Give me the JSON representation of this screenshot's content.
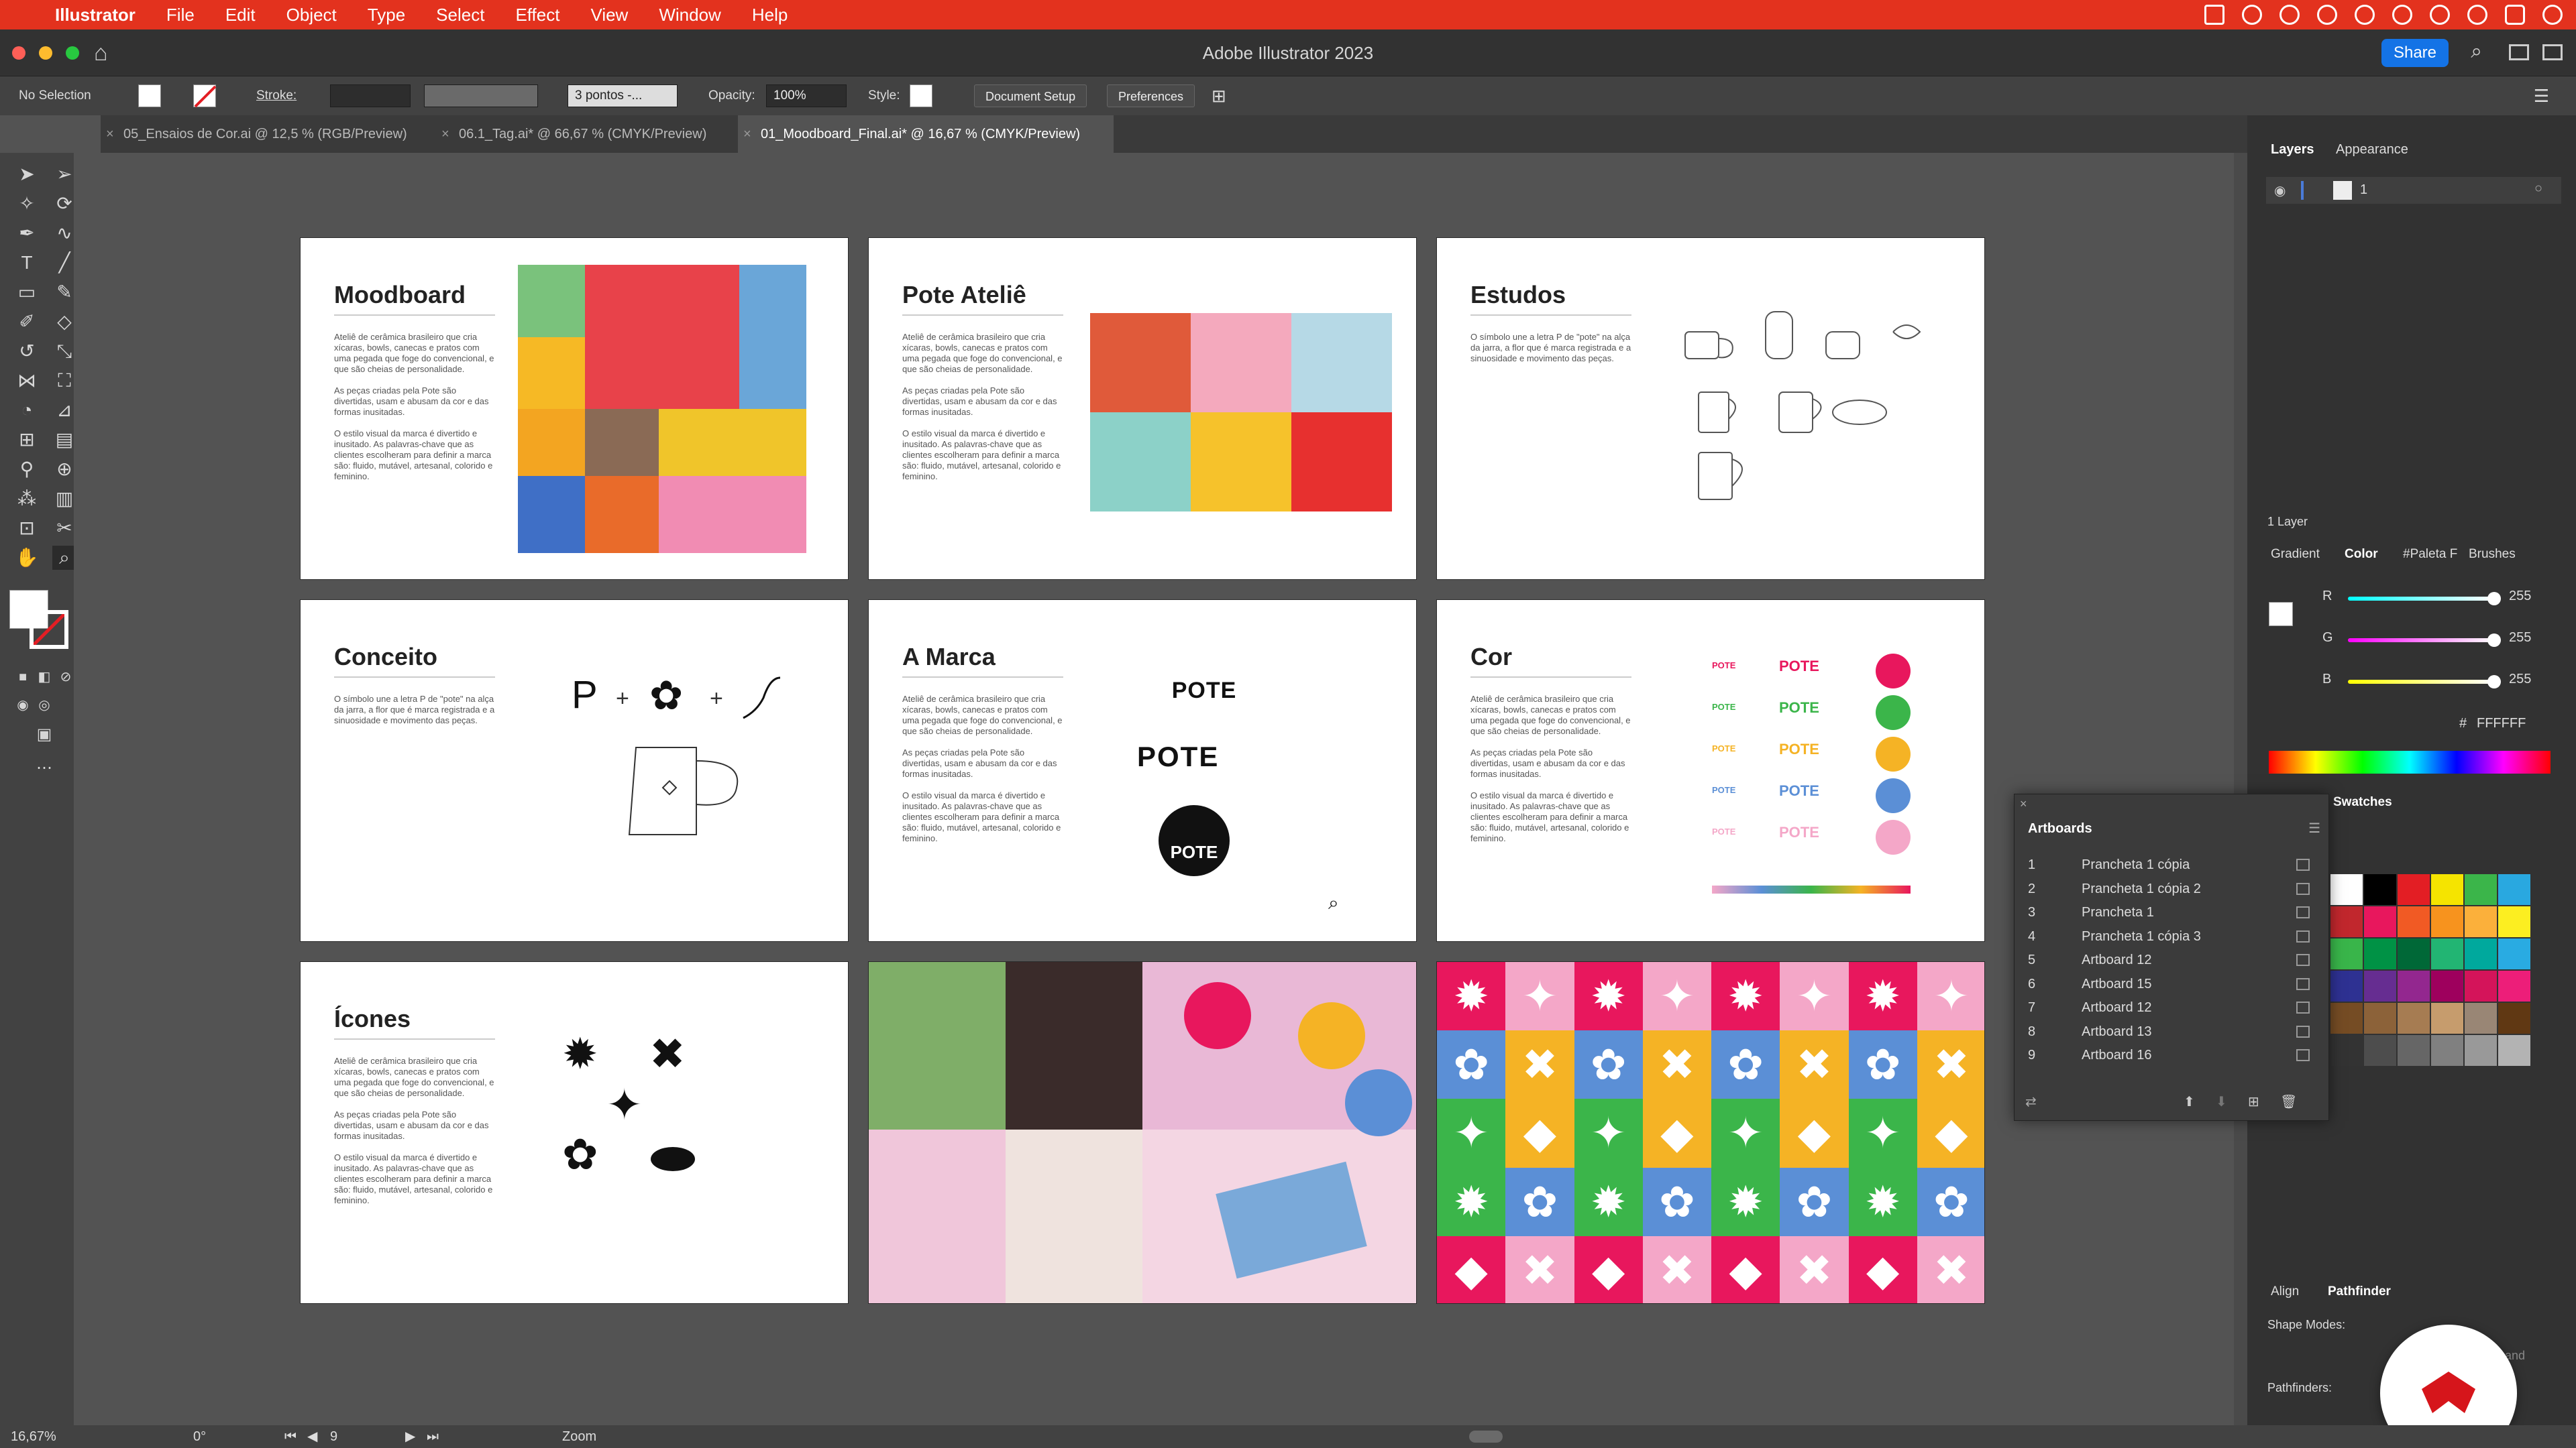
{
  "menubar": {
    "app": "Illustrator",
    "items": [
      "File",
      "Edit",
      "Object",
      "Type",
      "Select",
      "Effect",
      "View",
      "Window",
      "Help"
    ]
  },
  "titlebar": {
    "title": "Adobe Illustrator 2023",
    "share": "Share"
  },
  "control": {
    "selection": "No Selection",
    "stroke_label": "Stroke:",
    "brush": "3 pontos -...",
    "opacity_label": "Opacity:",
    "opacity": "100%",
    "style_label": "Style:",
    "doc_setup": "Document Setup",
    "preferences": "Preferences"
  },
  "tabs": [
    {
      "label": "05_Ensaios de Cor.ai @ 12,5 % (RGB/Preview)"
    },
    {
      "label": "06.1_Tag.ai* @ 66,67 % (CMYK/Preview)"
    },
    {
      "label": "01_Moodboard_Final.ai* @ 16,67 % (CMYK/Preview)"
    }
  ],
  "artboards_canvas": {
    "moodboard": "Moodboard",
    "pote_atelie": "Pote Ateliê",
    "estudos": "Estudos",
    "conceito": "Conceito",
    "a_marca": "A Marca",
    "cor": "Cor",
    "icones": "Ícones",
    "body_long": "Ateliê de cerâmica brasileiro que cria xícaras, bowls, canecas e pratos com uma pegada que foge do convencional, e que são cheias de personalidade.\n\nAs peças criadas pela Pote são divertidas, usam e abusam da cor e das formas inusitadas.\n\nO estilo visual da marca é divertido e inusitado. As palavras-chave que as clientes escolheram para definir a marca são: fluido, mutável, artesanal, colorido e feminino.",
    "body_short": "O símbolo une a letra P de \"pote\" na alça da jarra, a flor que é marca registrada e a sinuosidade e movimento das peças.",
    "logo_word": "POTE",
    "concept_p": "P",
    "concept_plus": "+"
  },
  "panels": {
    "layers_tab": "Layers",
    "appearance_tab": "Appearance",
    "layer_name": "1",
    "layer_count": "1 Layer",
    "gradient_tab": "Gradient",
    "color_tab": "Color",
    "paleta_tab": "#Paleta F",
    "brushes_tab": "Brushes",
    "r_label": "R",
    "g_label": "G",
    "b_label": "B",
    "r": "255",
    "g": "255",
    "b": "255",
    "hex_label": "#",
    "hex": "FFFFFF",
    "swatches_tab": "Swatches",
    "align_tab": "Align",
    "pathfinder_tab": "Pathfinder",
    "shape_modes": "Shape Modes:",
    "pathfinders": "Pathfinders:",
    "expand": "and"
  },
  "artboards_panel": {
    "title": "Artboards",
    "rows": [
      {
        "num": "1",
        "name": "Prancheta 1 cópia"
      },
      {
        "num": "2",
        "name": "Prancheta 1 cópia 2"
      },
      {
        "num": "3",
        "name": "Prancheta 1"
      },
      {
        "num": "4",
        "name": "Prancheta 1 cópia 3"
      },
      {
        "num": "5",
        "name": "Artboard 12"
      },
      {
        "num": "6",
        "name": "Artboard 15"
      },
      {
        "num": "7",
        "name": "Artboard 12"
      },
      {
        "num": "8",
        "name": "Artboard 13"
      },
      {
        "num": "9",
        "name": "Artboard 16"
      }
    ]
  },
  "status": {
    "zoom": "16,67%",
    "rotation": "0°",
    "artboard": "9",
    "tool": "Zoom"
  },
  "colors": {
    "menubar": "#e3321e",
    "pink": "#e8175d",
    "yellow": "#f5b325",
    "green": "#3bb54a",
    "blue": "#5b8fd6",
    "lightpink": "#f4a7c8"
  },
  "swatches": [
    "#ffffff",
    "#000000",
    "#e31e24",
    "#f5e400",
    "#3bb54a",
    "#29a8e0",
    "#c1272d",
    "#e8175d",
    "#f15a24",
    "#f7931e",
    "#fbb03b",
    "#fcee21",
    "#39b54a",
    "#009245",
    "#006837",
    "#22b573",
    "#00a99d",
    "#29abe2",
    "#2e3192",
    "#662d91",
    "#93278f",
    "#9e005d",
    "#d4145a",
    "#ed1e79",
    "#754c24",
    "#8c6239",
    "#a67c52",
    "#c69c6d",
    "#998675",
    "#603813",
    "#333333",
    "#4d4d4d",
    "#666666",
    "#808080",
    "#999999",
    "#b3b3b3"
  ]
}
